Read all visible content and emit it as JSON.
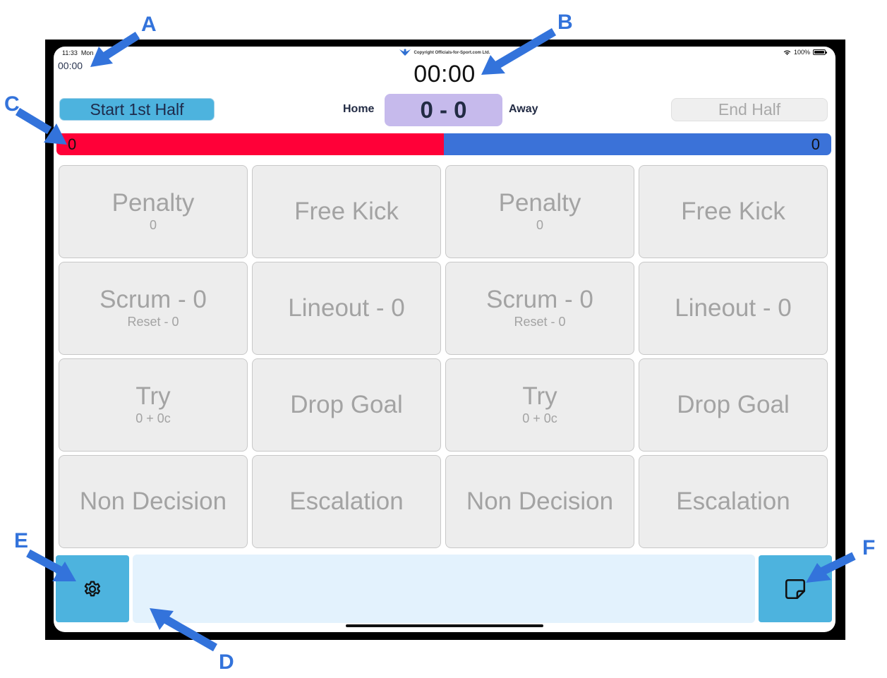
{
  "status_bar": {
    "time": "11:33",
    "date_partial": "Mon",
    "battery": "100%",
    "icons": [
      "wifi-icon",
      "battery-icon"
    ]
  },
  "header": {
    "small_clock": "00:00",
    "copyright": "Copyright Officials-for-Sport.com Ltd.",
    "main_clock": "00:00",
    "start_button": "Start 1st Half",
    "home_label": "Home",
    "score": "0 - 0",
    "away_label": "Away",
    "end_button": "End Half"
  },
  "possession": {
    "home_value": "0",
    "away_value": "0",
    "home_fraction": 0.5,
    "home_color": "#ff0038",
    "away_color": "#3b72d8"
  },
  "grid": {
    "cells": [
      {
        "label": "Penalty",
        "sub": "0"
      },
      {
        "label": "Free Kick",
        "sub": ""
      },
      {
        "label": "Penalty",
        "sub": "0"
      },
      {
        "label": "Free Kick",
        "sub": ""
      },
      {
        "label": "Scrum - 0",
        "sub": "Reset - 0"
      },
      {
        "label": "Lineout - 0",
        "sub": ""
      },
      {
        "label": "Scrum - 0",
        "sub": "Reset - 0"
      },
      {
        "label": "Lineout - 0",
        "sub": ""
      },
      {
        "label": "Try",
        "sub": "0 + 0c"
      },
      {
        "label": "Drop Goal",
        "sub": ""
      },
      {
        "label": "Try",
        "sub": "0 + 0c"
      },
      {
        "label": "Drop Goal",
        "sub": ""
      },
      {
        "label": "Non Decision",
        "sub": ""
      },
      {
        "label": "Escalation",
        "sub": ""
      },
      {
        "label": "Non Decision",
        "sub": ""
      },
      {
        "label": "Escalation",
        "sub": ""
      }
    ]
  },
  "bottom": {
    "settings_icon": "gear-icon",
    "notes_value": "",
    "note_icon": "sticky-note-icon"
  },
  "annotations": {
    "a": "A",
    "b": "B",
    "c": "C",
    "d": "D",
    "e": "E",
    "f": "F"
  },
  "colors": {
    "accent": "#4db3de",
    "score_bg": "#c6baec",
    "notes_bg": "#e3f2fd",
    "annotation": "#3373db"
  }
}
